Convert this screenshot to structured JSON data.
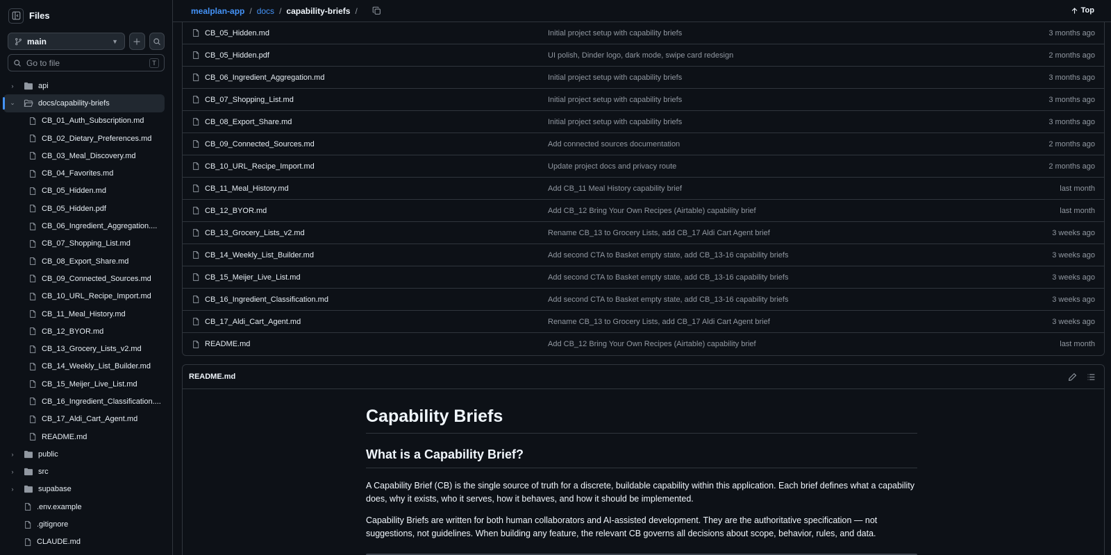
{
  "sidebar": {
    "title": "Files",
    "branch": "main",
    "goto_placeholder": "Go to file",
    "goto_shortcut": "T",
    "tree": [
      {
        "label": "api",
        "type": "dir",
        "expanded": false
      },
      {
        "label": "docs/capability-briefs",
        "type": "dir",
        "expanded": true,
        "active": true
      },
      {
        "label": "CB_01_Auth_Subscription.md",
        "type": "file",
        "child": true
      },
      {
        "label": "CB_02_Dietary_Preferences.md",
        "type": "file",
        "child": true
      },
      {
        "label": "CB_03_Meal_Discovery.md",
        "type": "file",
        "child": true
      },
      {
        "label": "CB_04_Favorites.md",
        "type": "file",
        "child": true
      },
      {
        "label": "CB_05_Hidden.md",
        "type": "file",
        "child": true
      },
      {
        "label": "CB_05_Hidden.pdf",
        "type": "file",
        "child": true
      },
      {
        "label": "CB_06_Ingredient_Aggregation....",
        "type": "file",
        "child": true
      },
      {
        "label": "CB_07_Shopping_List.md",
        "type": "file",
        "child": true
      },
      {
        "label": "CB_08_Export_Share.md",
        "type": "file",
        "child": true
      },
      {
        "label": "CB_09_Connected_Sources.md",
        "type": "file",
        "child": true
      },
      {
        "label": "CB_10_URL_Recipe_Import.md",
        "type": "file",
        "child": true
      },
      {
        "label": "CB_11_Meal_History.md",
        "type": "file",
        "child": true
      },
      {
        "label": "CB_12_BYOR.md",
        "type": "file",
        "child": true
      },
      {
        "label": "CB_13_Grocery_Lists_v2.md",
        "type": "file",
        "child": true
      },
      {
        "label": "CB_14_Weekly_List_Builder.md",
        "type": "file",
        "child": true
      },
      {
        "label": "CB_15_Meijer_Live_List.md",
        "type": "file",
        "child": true
      },
      {
        "label": "CB_16_Ingredient_Classification....",
        "type": "file",
        "child": true
      },
      {
        "label": "CB_17_Aldi_Cart_Agent.md",
        "type": "file",
        "child": true
      },
      {
        "label": "README.md",
        "type": "file",
        "child": true
      },
      {
        "label": "public",
        "type": "dir",
        "expanded": false
      },
      {
        "label": "src",
        "type": "dir",
        "expanded": false
      },
      {
        "label": "supabase",
        "type": "dir",
        "expanded": false
      },
      {
        "label": ".env.example",
        "type": "file"
      },
      {
        "label": ".gitignore",
        "type": "file"
      },
      {
        "label": "CLAUDE.md",
        "type": "file"
      }
    ]
  },
  "breadcrumb": {
    "repo": "mealplan-app",
    "folder": "docs",
    "current": "capability-briefs",
    "trailing": "/"
  },
  "top_label": "Top",
  "files": [
    {
      "name": "CB_05_Hidden.md",
      "message": "Initial project setup with capability briefs",
      "age": "3 months ago"
    },
    {
      "name": "CB_05_Hidden.pdf",
      "message": "UI polish, Dinder logo, dark mode, swipe card redesign",
      "age": "2 months ago"
    },
    {
      "name": "CB_06_Ingredient_Aggregation.md",
      "message": "Initial project setup with capability briefs",
      "age": "3 months ago"
    },
    {
      "name": "CB_07_Shopping_List.md",
      "message": "Initial project setup with capability briefs",
      "age": "3 months ago"
    },
    {
      "name": "CB_08_Export_Share.md",
      "message": "Initial project setup with capability briefs",
      "age": "3 months ago"
    },
    {
      "name": "CB_09_Connected_Sources.md",
      "message": "Add connected sources documentation",
      "age": "2 months ago"
    },
    {
      "name": "CB_10_URL_Recipe_Import.md",
      "message": "Update project docs and privacy route",
      "age": "2 months ago"
    },
    {
      "name": "CB_11_Meal_History.md",
      "message": "Add CB_11 Meal History capability brief",
      "age": "last month"
    },
    {
      "name": "CB_12_BYOR.md",
      "message": "Add CB_12 Bring Your Own Recipes (Airtable) capability brief",
      "age": "last month"
    },
    {
      "name": "CB_13_Grocery_Lists_v2.md",
      "message": "Rename CB_13 to Grocery Lists, add CB_17 Aldi Cart Agent brief",
      "age": "3 weeks ago"
    },
    {
      "name": "CB_14_Weekly_List_Builder.md",
      "message": "Add second CTA to Basket empty state, add CB_13-16 capability briefs",
      "age": "3 weeks ago"
    },
    {
      "name": "CB_15_Meijer_Live_List.md",
      "message": "Add second CTA to Basket empty state, add CB_13-16 capability briefs",
      "age": "3 weeks ago"
    },
    {
      "name": "CB_16_Ingredient_Classification.md",
      "message": "Add second CTA to Basket empty state, add CB_13-16 capability briefs",
      "age": "3 weeks ago"
    },
    {
      "name": "CB_17_Aldi_Cart_Agent.md",
      "message": "Rename CB_13 to Grocery Lists, add CB_17 Aldi Cart Agent brief",
      "age": "3 weeks ago"
    },
    {
      "name": "README.md",
      "message": "Add CB_12 Bring Your Own Recipes (Airtable) capability brief",
      "age": "last month"
    }
  ],
  "readme": {
    "filename": "README.md",
    "h1": "Capability Briefs",
    "h2": "What is a Capability Brief?",
    "p1": "A Capability Brief (CB) is the single source of truth for a discrete, buildable capability within this application. Each brief defines what a capability does, why it exists, who it serves, how it behaves, and how it should be implemented.",
    "p2": "Capability Briefs are written for both human collaborators and AI-assisted development. They are the authoritative specification — not suggestions, not guidelines. When building any feature, the relevant CB governs all decisions about scope, behavior, rules, and data."
  }
}
